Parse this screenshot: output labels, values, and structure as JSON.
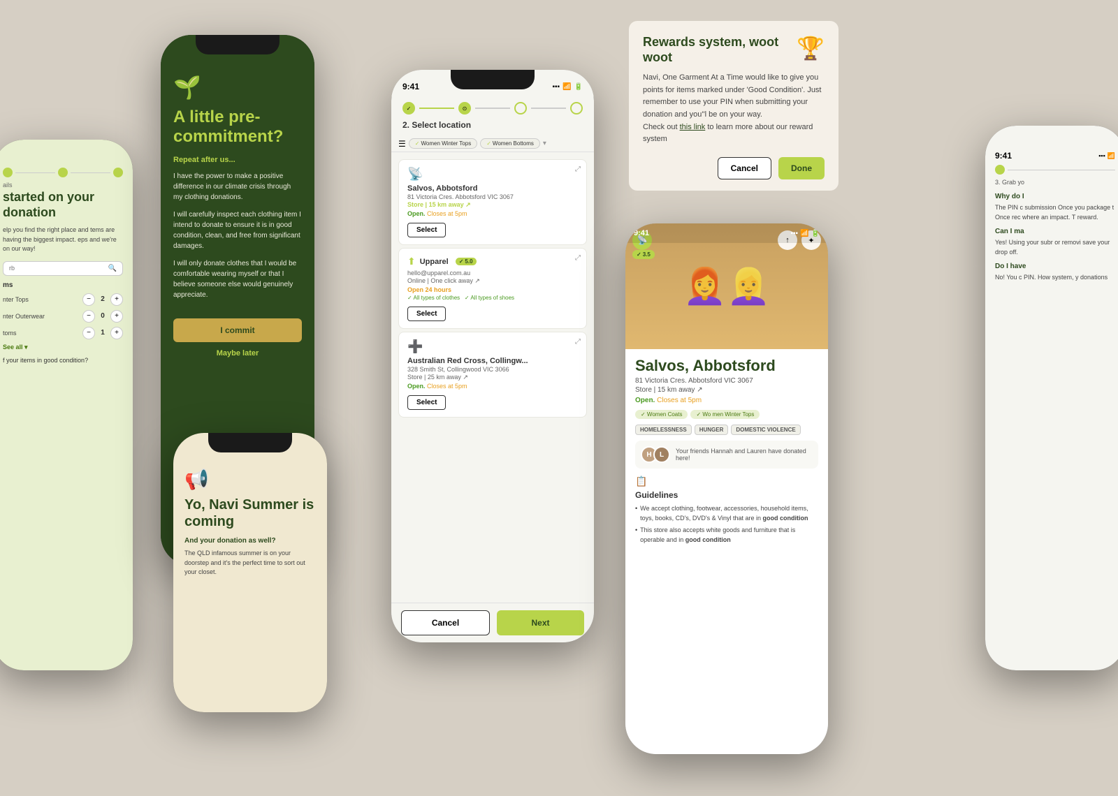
{
  "background": "#d6cfc4",
  "phone1": {
    "icon": "🌱",
    "title": "A little pre-commitment?",
    "subtitle": "Repeat after us...",
    "body1": "I have the power to make a positive difference in our climate crisis through my clothing donations.",
    "body2": "I will carefully inspect each clothing item I intend to donate to ensure it is in good condition, clean, and free from significant damages.",
    "body3": "I will only donate clothes that I would be comfortable wearing myself or that I believe someone else would genuinely appreciate.",
    "commit_btn": "I commit",
    "later_btn": "Maybe later"
  },
  "phone2": {
    "icon": "📢",
    "title": "Yo, Navi Summer is coming",
    "subtitle": "And your donation as well?",
    "body": "The QLD infamous summer is on your doorstep and it's the perfect time to sort out your closet."
  },
  "phone3": {
    "time": "9:41",
    "step_label": "2. Select location",
    "filters": [
      "Women Winter Tops",
      "Women Bottoms"
    ],
    "locations": [
      {
        "name": "Salvos, Abbotsford",
        "address": "81 Victoria Cres. Abbotsford VIC 3067",
        "type": "Store",
        "distance": "15 km away",
        "status": "Open. Closes at 5pm",
        "logo": "📡",
        "select_btn": "Select"
      },
      {
        "name": "Upparel",
        "rating": "5.0",
        "address": "hello@upparel.com.au",
        "type": "Online",
        "distance": "One click away",
        "status": "Open 24 hours",
        "tags": [
          "All types of clothes",
          "All types of shoes"
        ],
        "logo": "⬆️",
        "select_btn": "Select"
      },
      {
        "name": "Australian Red Cross, Collingw...",
        "address": "328 Smith St, Collingwood VIC 3066",
        "type": "Store",
        "distance": "25 km away",
        "status": "Open. Closes at 5pm",
        "logo": "➕",
        "select_btn": "Select"
      }
    ],
    "cancel_btn": "Cancel",
    "next_btn": "Next"
  },
  "rewards": {
    "title": "Rewards system, woot woot",
    "icon": "🏆",
    "body": "Navi, One Garment At a Time would like to give you points for items marked under 'Good Condition'. Just remember to use your PIN when submitting your donation and you''l be on your way.\nCheck out this link to learn more about our reward system",
    "link_text": "this link",
    "cancel_btn": "Cancel",
    "done_btn": "Done"
  },
  "phone4": {
    "time": "9:41",
    "store_name": "Salvos, Abbotsford",
    "address": "81 Victoria Cres. Abbotsford VIC 3067",
    "store_type": "Store",
    "distance": "15 km away",
    "status_open": "Open.",
    "status_close": " Closes at 5pm",
    "rating": "3.5",
    "category_tags": [
      "Women Coats",
      "Wo men Winter Tops"
    ],
    "cause_tags": [
      "HOMELESSNESS",
      "HUNGER",
      "DOMESTIC VIOLENCE"
    ],
    "friends_text": "Your friends Hannah and Lauren have donated here!",
    "guidelines_title": "Guidelines",
    "guidelines": [
      "We accept clothing, footwear, accessories, household items, toys, books, CD's, DVD's & Vinyl that are in good condition",
      "This store also accepts white goods and furniture that is operable and in good condition"
    ]
  },
  "phone_left": {
    "section_label": "ails",
    "title": "started on your donation",
    "body": "elp you find the right place and tems are having the biggest impact. eps and we're on our way!",
    "search_placeholder": "rb",
    "items_title": "ms",
    "items": [
      {
        "name": "nter Tops",
        "qty": 2
      },
      {
        "name": "nter Outerwear",
        "qty": 0
      },
      {
        "name": "toms",
        "qty": 1
      }
    ],
    "see_all": "See all ▾",
    "condition_text": "f your items in good condition?"
  },
  "phone_right": {
    "time": "9:41",
    "grab_label": "3. Grab yo",
    "why_title": "Why do I",
    "why_body": "The PIN c submission Once you package t Once rec where an impact. T reward.",
    "can_title": "Can I ma",
    "can_body": "Yes! Using your subr or removi save your drop off.",
    "have_title": "Do I have",
    "have_body": "No! You c PIN. How system, y donations"
  }
}
